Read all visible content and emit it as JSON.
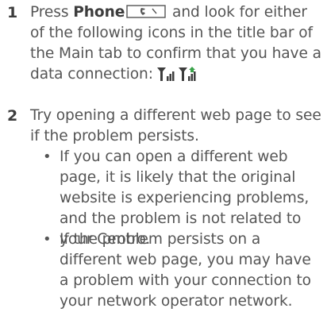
{
  "step1": {
    "number": "1",
    "before": "Press ",
    "key_label": "Phone",
    "after": " and look for either of the following icons in the title bar of the Main tab to confirm that you have a data connection:",
    "icons": [
      "data-signal-icon",
      "data-signal-active-icon"
    ],
    "accent_color": "#3aa34a"
  },
  "step2": {
    "number": "2",
    "text": "Try opening a different web page to see if the problem persists.",
    "bullets": [
      {
        "text": "If you can open a different web page, it is likely that the original website is experiencing problems, and the problem is not related to your Centro."
      },
      {
        "text": "If the problem persists on a different web page, you may have a problem with your connection to your network operator network."
      }
    ]
  }
}
